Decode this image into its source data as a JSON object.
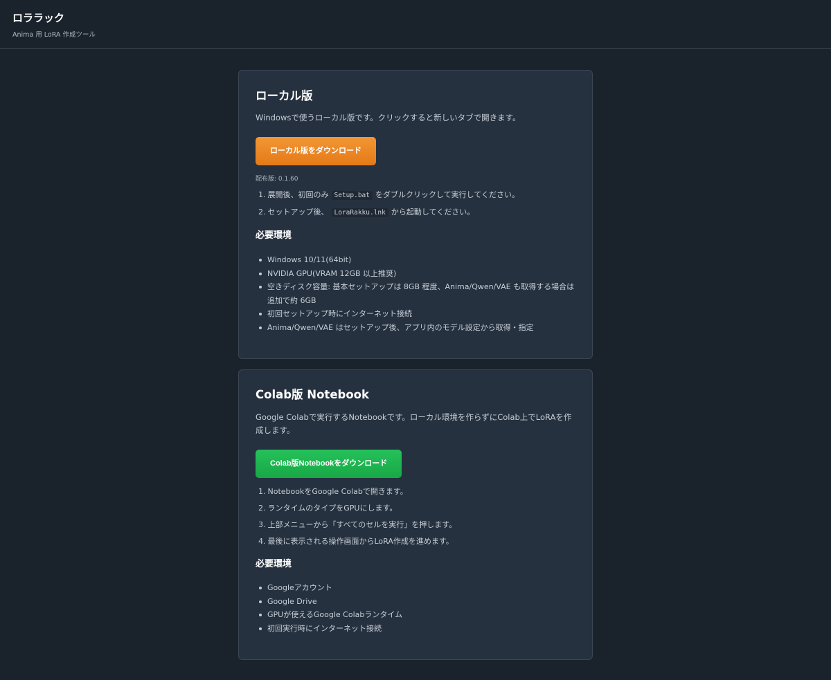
{
  "header": {
    "title": "ロララック",
    "subtitle": "Anima 用 LoRA 作成ツール"
  },
  "local": {
    "title": "ローカル版",
    "description": "Windowsで使うローカル版です。クリックすると新しいタブで開きます。",
    "button_label": "ローカル版をダウンロード",
    "version": "配布版: 0.1.60",
    "steps": [
      {
        "num": "1.",
        "before": "展開後、初回のみ",
        "code": "Setup.bat",
        "after": "をダブルクリックして実行してください。"
      },
      {
        "num": "2.",
        "before": "セットアップ後、",
        "code": "LoraRakku.lnk",
        "after": "から起動してください。"
      }
    ],
    "requirements_title": "必要環境",
    "requirements": [
      "Windows 10/11(64bit)",
      "NVIDIA GPU(VRAM 12GB 以上推奨)",
      "空きディスク容量: 基本セットアップは 8GB 程度、Anima/Qwen/VAE も取得する場合は追加で約 6GB",
      "初回セットアップ時にインターネット接続",
      "Anima/Qwen/VAE はセットアップ後、アプリ内のモデル設定から取得・指定"
    ]
  },
  "colab": {
    "title": "Colab版 Notebook",
    "description": "Google Colabで実行するNotebookです。ローカル環境を作らずにColab上でLoRAを作成します。",
    "button_label": "Colab版Notebookをダウンロード",
    "steps": [
      {
        "num": "1.",
        "text": "NotebookをGoogle Colabで開きます。"
      },
      {
        "num": "2.",
        "text": "ランタイムのタイプをGPUにします。"
      },
      {
        "num": "3.",
        "text": "上部メニューから「すべてのセルを実行」を押します。"
      },
      {
        "num": "4.",
        "text": "最後に表示される操作画面からLoRA作成を進めます。"
      }
    ],
    "requirements_title": "必要環境",
    "requirements": [
      "Googleアカウント",
      "Google Drive",
      "GPUが使えるGoogle Colabランタイム",
      "初回実行時にインターネット接続"
    ]
  },
  "colors": {
    "background": "#1a232b",
    "card": "#26313f",
    "orange_button": "#f08a26",
    "green_button": "#1fb650"
  }
}
